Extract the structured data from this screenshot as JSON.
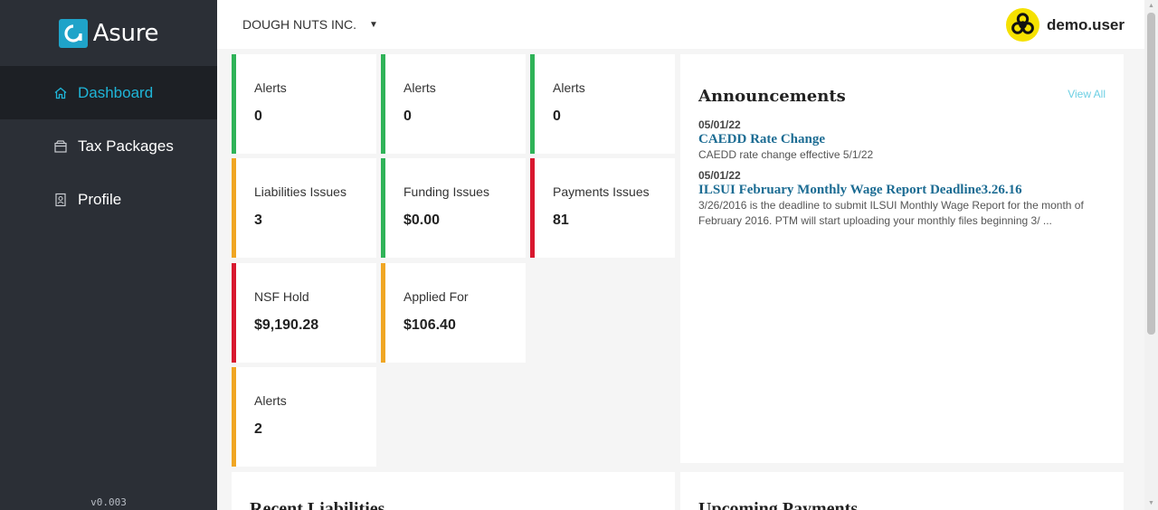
{
  "brand": {
    "name": "Asure"
  },
  "sidebar": {
    "items": [
      {
        "label": "Dashboard",
        "icon": "home-icon",
        "active": true
      },
      {
        "label": "Tax Packages",
        "icon": "package-icon",
        "active": false
      },
      {
        "label": "Profile",
        "icon": "profile-icon",
        "active": false
      }
    ],
    "version": "v0.003"
  },
  "header": {
    "company": "DOUGH NUTS INC.",
    "username": "demo.user",
    "avatar_icon": "biohazard-icon"
  },
  "cards": [
    {
      "label": "Alerts",
      "value": "0",
      "status": "green"
    },
    {
      "label": "Alerts",
      "value": "0",
      "status": "green"
    },
    {
      "label": "Alerts",
      "value": "0",
      "status": "green"
    },
    {
      "label": "Liabilities Issues",
      "value": "3",
      "status": "orange"
    },
    {
      "label": "Funding Issues",
      "value": "$0.00",
      "status": "green"
    },
    {
      "label": "Payments Issues",
      "value": "81",
      "status": "red"
    },
    {
      "label": "NSF Hold",
      "value": "$9,190.28",
      "status": "red"
    },
    {
      "label": "Applied For",
      "value": "$106.40",
      "status": "orange"
    },
    {
      "label": "Alerts",
      "value": "2",
      "status": "orange"
    }
  ],
  "announcements": {
    "title": "Announcements",
    "view_all": "View All",
    "items": [
      {
        "date": "05/01/22",
        "headline": "CAEDD Rate Change",
        "body": "CAEDD rate change effective 5/1/22"
      },
      {
        "date": "05/01/22",
        "headline": "ILSUI February Monthly Wage Report Deadline3.26.16",
        "body": "3/26/2016 is the deadline to submit ILSUI Monthly Wage Report for the month of February 2016. PTM will start uploading your monthly files beginning 3/ ..."
      }
    ]
  },
  "bottom_panels": [
    {
      "title": "Recent Liabilities"
    },
    {
      "title": "Upcoming Payments"
    }
  ],
  "colors": {
    "sidebar": "#2b2f36",
    "active_nav": "#1d2025",
    "accent": "#1fb5d8",
    "green": "#2fb358",
    "orange": "#f0a623",
    "red": "#d8182f",
    "link": "#1c6c93"
  }
}
